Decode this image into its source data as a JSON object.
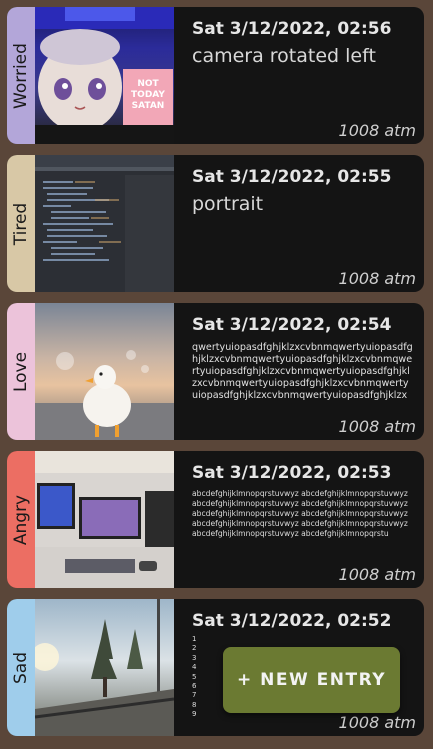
{
  "entries": [
    {
      "mood": "Worried",
      "mood_color": "#b3a6d9",
      "date": "Sat 3/12/2022, 02:56",
      "text": "camera rotated left",
      "pressure": "1008 atm"
    },
    {
      "mood": "Tired",
      "mood_color": "#d8c8a6",
      "date": "Sat 3/12/2022, 02:55",
      "text": "portrait",
      "pressure": "1008 atm"
    },
    {
      "mood": "Love",
      "mood_color": "#ecc3da",
      "date": "Sat 3/12/2022, 02:54",
      "text": "qwertyuiopasdfghjklzxcvbnmqwertyuiopasdfghjklzxcvbnmqwertyuiopasdfghjklzxcvbnmqwertyuiopasdfghjklzxcvbnmqwertyuiopasdfghjklzxcvbnmqwertyuiopasdfghjklzxcvbnmqwertyuiopasdfghjklzxcvbnmqwertyuiopasdfghjklzx",
      "pressure": "1008 atm"
    },
    {
      "mood": "Angry",
      "mood_color": "#ec6e63",
      "date": "Sat 3/12/2022, 02:53",
      "text": "abcdefghijklmnopqrstuvwyz abcdefghijklmnopqrstuvwyz abcdefghijklmnopqrstuvwyz abcdefghijklmnopqrstuvwyz abcdefghijklmnopqrstuvwyz abcdefghijklmnopqrstuvwyz abcdefghijklmnopqrstuvwyz abcdefghijklmnopqrstuvwyz abcdefghijklmnopqrstuvwyz abcdefghijklmnopqrstu",
      "pressure": "1008 atm"
    },
    {
      "mood": "Sad",
      "mood_color": "#9fcdeb",
      "date": "Sat 3/12/2022, 02:52",
      "lines": [
        "1",
        "2",
        "3",
        "4",
        "5",
        "6",
        "7",
        "8",
        "9"
      ],
      "pressure": "1008 atm"
    }
  ],
  "photo_sign_text": "NOT TODAY SATAN",
  "fab_label": "+ NEW ENTRY"
}
